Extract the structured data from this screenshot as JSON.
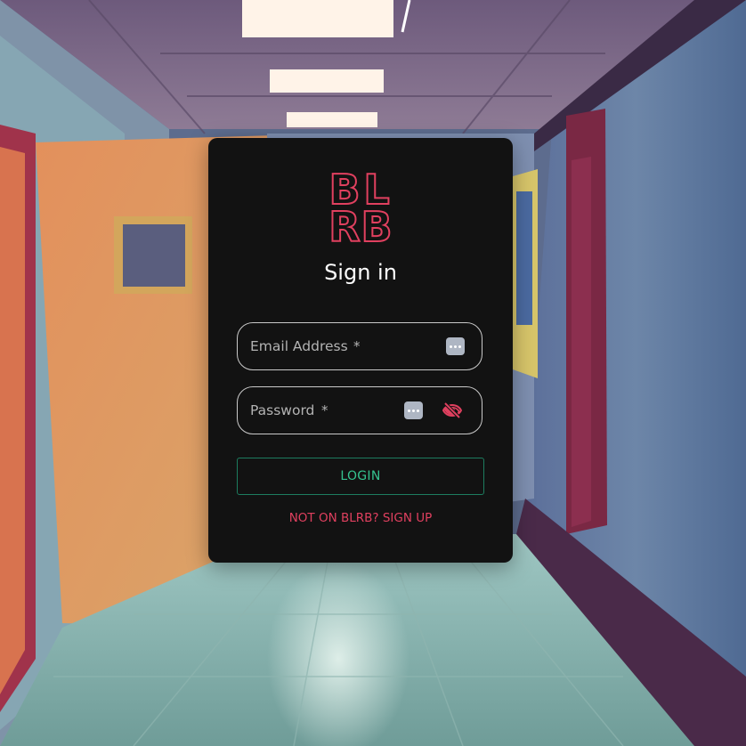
{
  "background": {
    "description_icon": "school-hallway-scene"
  },
  "brand": {
    "logo_letters": [
      "B",
      "L",
      "R",
      "B"
    ],
    "accent_color": "#e0405f",
    "success_color": "#35c38f"
  },
  "form": {
    "title": "Sign in",
    "email": {
      "label": "Email Address",
      "required_marker": "*",
      "value": ""
    },
    "password": {
      "label": "Password",
      "required_marker": "*",
      "value": ""
    },
    "login_label": "LOGIN",
    "signup_link": "NOT ON BLRB? SIGN UP"
  },
  "icons": {
    "password_manager": "password-manager-icon",
    "visibility_toggle": "eye-off-icon"
  }
}
